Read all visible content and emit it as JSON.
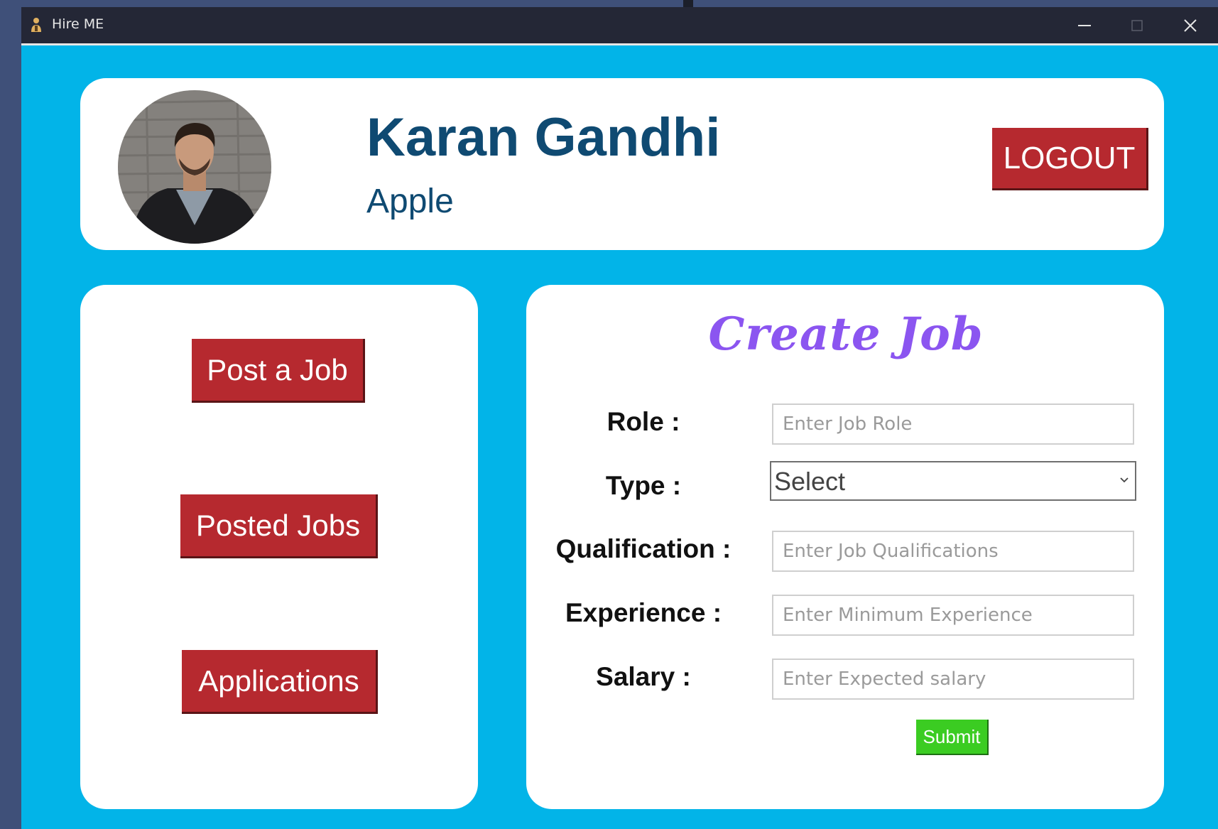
{
  "window": {
    "title": "Hire ME",
    "controls": [
      "minimize",
      "maximize",
      "close"
    ]
  },
  "header": {
    "name": "Karan Gandhi",
    "company": "Apple",
    "logout_label": "LOGOUT"
  },
  "menu": {
    "post_job_label": "Post a Job",
    "posted_jobs_label": "Posted Jobs",
    "applications_label": "Applications"
  },
  "form": {
    "title": "Create Job",
    "role": {
      "label": "Role :",
      "placeholder": "Enter Job Role",
      "value": ""
    },
    "type": {
      "label": "Type :",
      "selected": "Select"
    },
    "qualification": {
      "label": "Qualification :",
      "placeholder": "Enter Job Qualifications",
      "value": ""
    },
    "experience": {
      "label": "Experience :",
      "placeholder": "Enter Minimum Experience",
      "value": ""
    },
    "salary": {
      "label": "Salary :",
      "placeholder": "Enter Expected salary",
      "value": ""
    },
    "submit_label": "Submit"
  },
  "colors": {
    "background": "#02b4e8",
    "titlebar": "#242736",
    "button_red": "#b6292f",
    "name_blue": "#0f4a72",
    "title_purple": "#8b55f0",
    "submit_green": "#3bcc22"
  },
  "icons": {
    "app": "hire-me-person-icon",
    "minimize": "minimize-icon",
    "maximize": "maximize-icon",
    "close": "close-icon",
    "select": "chevron-down-icon"
  }
}
